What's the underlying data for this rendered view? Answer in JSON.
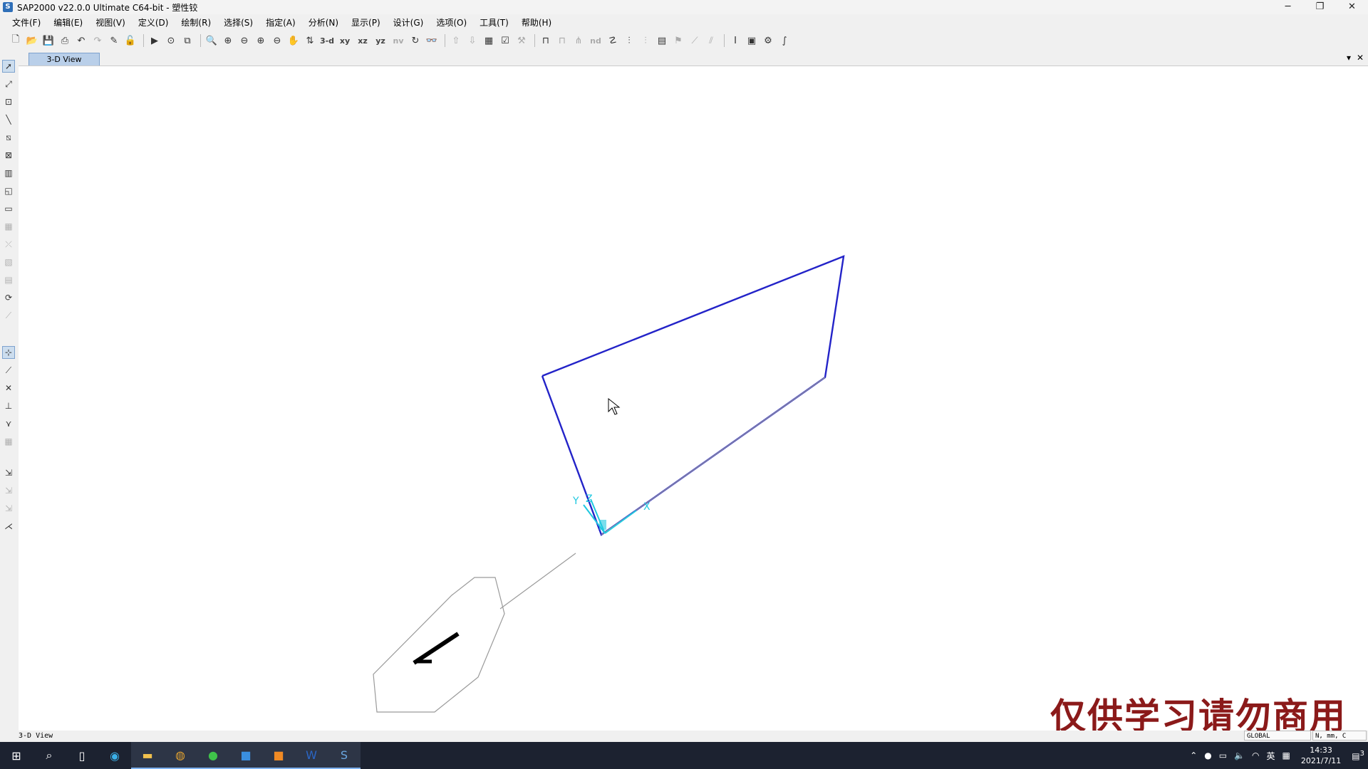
{
  "window": {
    "title": "SAP2000 v22.0.0 Ultimate C64-bit - 塑性铰",
    "app_letter": "S",
    "minimize": "─",
    "restore": "❐",
    "close": "✕"
  },
  "menu": [
    "文件(F)",
    "编辑(E)",
    "视图(V)",
    "定义(D)",
    "绘制(R)",
    "选择(S)",
    "指定(A)",
    "分析(N)",
    "显示(P)",
    "设计(G)",
    "选项(O)",
    "工具(T)",
    "帮助(H)"
  ],
  "toolbar": {
    "view_3d": "3-d",
    "view_xy": "xy",
    "view_xz": "xz",
    "view_yz": "yz",
    "view_nv": "nv",
    "nd": "nd"
  },
  "tab": {
    "label": "3-D View",
    "dropdown": "▾",
    "close": "✕"
  },
  "viewport": {
    "axis_x": "X",
    "axis_y": "Y",
    "axis_z": "Z",
    "watermark": "仅供学习请勿商用",
    "frame_color": "#2323c8",
    "axis_color": "#20c8e0"
  },
  "status": {
    "view": "3-D View",
    "coord_system": "GLOBAL",
    "units": "N, mm, C"
  },
  "taskbar": {
    "apps": [
      "start-icon",
      "search-icon",
      "task-view-icon",
      "edge-icon",
      "file-explorer-icon",
      "chrome-icon",
      "wechat-icon",
      "app-icon",
      "app-orange-icon",
      "word-icon",
      "sap2000-icon"
    ],
    "tray_lang": "英",
    "time": "14:33",
    "date": "2021/7/11",
    "notifications": "3"
  }
}
